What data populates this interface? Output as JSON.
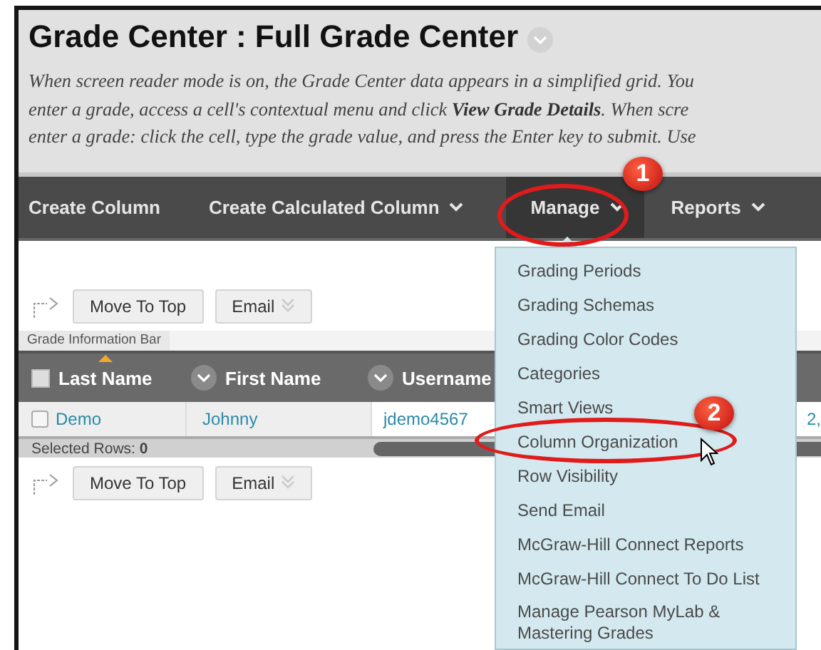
{
  "page_title": "Grade Center : Full Grade Center",
  "description_lines": [
    "When screen reader mode is on, the Grade Center data appears in a simplified grid. You",
    "enter a grade, access a cell's contextual menu and click **View Grade Details**. When scre",
    "enter a grade: click the cell, type the grade value, and press the Enter key to submit. Use"
  ],
  "nav": [
    {
      "label": "Create Column",
      "has_caret": false,
      "selected": false
    },
    {
      "label": "Create Calculated Column",
      "has_caret": true,
      "selected": false
    },
    {
      "label": "Manage",
      "has_caret": true,
      "selected": true
    },
    {
      "label": "Reports",
      "has_caret": true,
      "selected": false
    }
  ],
  "top_actions": [
    "Move To Top",
    "Email"
  ],
  "info_bar_tab": "Grade Information Bar",
  "table": {
    "all_selected": false,
    "columns": [
      {
        "label": "Last Name",
        "sorted": true
      },
      {
        "label": "First Name",
        "sorted": false
      },
      {
        "label": "Username",
        "sorted": false
      }
    ],
    "rows": [
      {
        "checked": false,
        "cells": [
          "Demo",
          "Johnny",
          "jdemo4567",
          "2,"
        ]
      }
    ]
  },
  "selected_rows": "Selected Rows: **0**",
  "bottom_actions": [
    "Move To Top",
    "Email"
  ],
  "manage_menu": [
    "Grading Periods",
    "Grading Schemas",
    "Grading Color Codes",
    "Categories",
    "Smart Views",
    "Column Organization",
    "Row Visibility",
    "Send Email",
    "McGraw-Hill Connect Reports",
    "McGraw-Hill Connect To Do List",
    "Manage Pearson MyLab & Mastering Grades"
  ],
  "callouts": [
    {
      "number": "1"
    },
    {
      "number": "2"
    }
  ]
}
